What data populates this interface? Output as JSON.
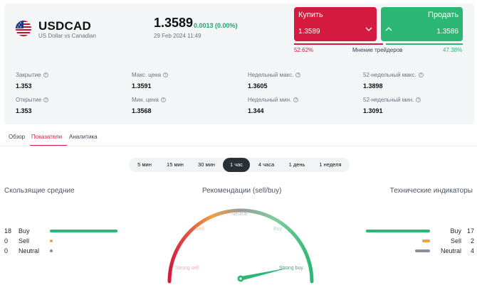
{
  "header": {
    "symbol": "USDCAD",
    "description": "US Dollar vs Canadian",
    "price": "1.3589",
    "change": "0.0013 (0.00%)",
    "timestamp": "29 Feb 2024 11:49",
    "flag_icon": "us-flag-icon"
  },
  "trade": {
    "buy_label": "Купить",
    "buy_price": "1.3589",
    "sell_label": "Продать",
    "sell_price": "1.3586",
    "buy_pct": "52.62%",
    "sell_pct": "47.38%",
    "buy_share": 0.5262,
    "sentiment_label": "Мнение трейдеров",
    "buy_color": "#d41a3f",
    "sell_color": "#2cb774"
  },
  "stats": [
    {
      "label": "Закрытие",
      "value": "1.353"
    },
    {
      "label": "Макс. цена",
      "value": "1.3591"
    },
    {
      "label": "Недельный макс.",
      "value": "1.3605"
    },
    {
      "label": "52-недельный макс.",
      "value": "1.3898"
    },
    {
      "label": "Открытие",
      "value": "1.353"
    },
    {
      "label": "Мин. цена",
      "value": "1.3568"
    },
    {
      "label": "Недельный мин.",
      "value": "1.344"
    },
    {
      "label": "52-недельный мин.",
      "value": "1.3091"
    }
  ],
  "tabs": [
    {
      "label": "Обзор",
      "active": false
    },
    {
      "label": "Показатели",
      "active": true
    },
    {
      "label": "Аналитика",
      "active": false
    }
  ],
  "timeframes": [
    {
      "label": "5 мин",
      "active": false
    },
    {
      "label": "15 мин",
      "active": false
    },
    {
      "label": "30 мин",
      "active": false
    },
    {
      "label": "1 час",
      "active": true
    },
    {
      "label": "4 часа",
      "active": false
    },
    {
      "label": "1 день",
      "active": false
    },
    {
      "label": "1 неделя",
      "active": false
    }
  ],
  "moving_averages": {
    "title": "Скользящие средние",
    "rows": [
      {
        "count": "18",
        "label": "Buy",
        "value": 18,
        "color": "#2cb774"
      },
      {
        "count": "0",
        "label": "Sell",
        "value": 0,
        "color": "#f0a040"
      },
      {
        "count": "0",
        "label": "Neutral",
        "value": 0,
        "color": "#8a8f98"
      }
    ]
  },
  "recommendation": {
    "title": "Рекомендации (sell/buy)",
    "zones": [
      "Strong sell",
      "Sell",
      "Neutral",
      "Buy",
      "Strong buy"
    ],
    "active_zone": "Strong buy",
    "needle_value": 0.93
  },
  "technical": {
    "title": "Технические индикаторы",
    "rows": [
      {
        "count": "17",
        "label": "Buy",
        "value": 17,
        "color": "#2cb774"
      },
      {
        "count": "2",
        "label": "Sell",
        "value": 2,
        "color": "#f0a040"
      },
      {
        "count": "4",
        "label": "Neutral",
        "value": 4,
        "color": "#8a8f98"
      }
    ]
  }
}
